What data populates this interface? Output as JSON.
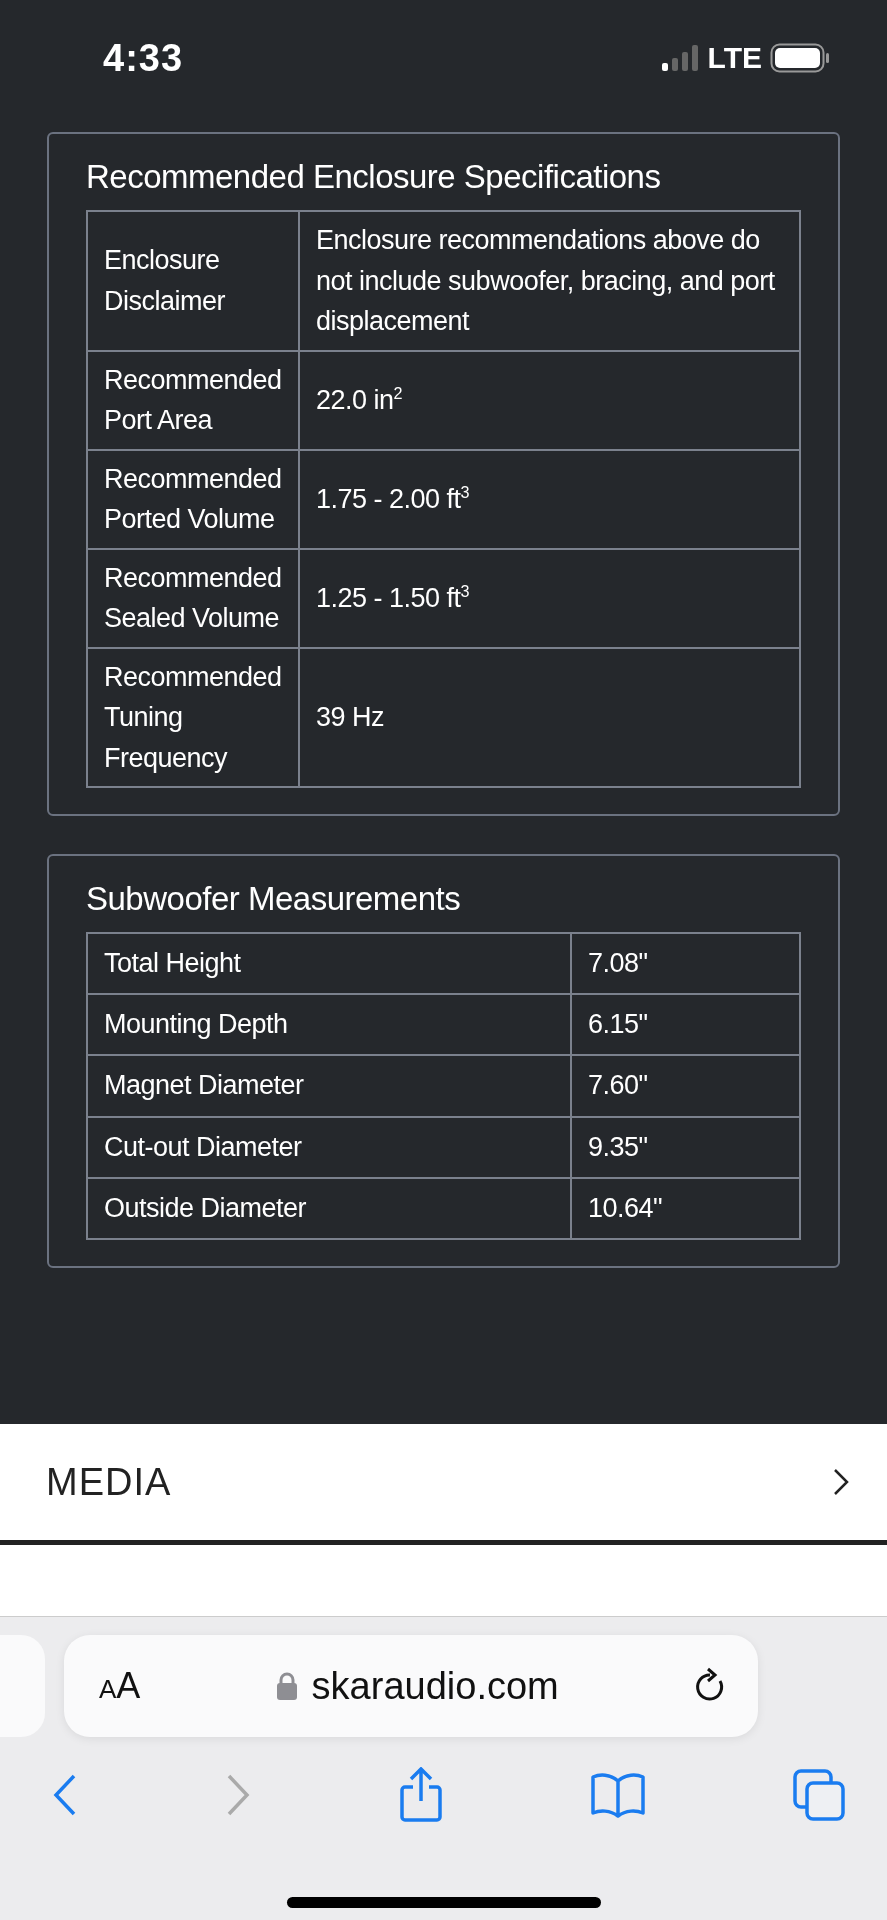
{
  "status_bar": {
    "time": "4:33",
    "network": "LTE"
  },
  "sections": [
    {
      "title": "Recommended Enclosure Specifications",
      "kind": "wide",
      "rows": [
        {
          "label": "Enclosure Disclaimer",
          "value": "Enclosure recommendations above do not include subwoofer, bracing, and port displacement"
        },
        {
          "label": "Recommended Port Area",
          "value": "22.0 in$^{2}$"
        },
        {
          "label": "Recommended Ported Volume",
          "value": "1.75 - 2.00 ft$^{3}$"
        },
        {
          "label": "Recommended Sealed Volume",
          "value": "1.25 - 1.50 ft$^{3}$"
        },
        {
          "label": "Recommended Tuning Frequency",
          "value": "39 Hz"
        }
      ]
    },
    {
      "title": "Subwoofer Measurements",
      "kind": "narrow",
      "rows": [
        {
          "label": "Total Height",
          "value": "7.08\""
        },
        {
          "label": "Mounting Depth",
          "value": "6.15\""
        },
        {
          "label": "Magnet Diameter",
          "value": "7.60\""
        },
        {
          "label": "Cut-out Diameter",
          "value": "9.35\""
        },
        {
          "label": "Outside Diameter",
          "value": "10.64\""
        }
      ]
    }
  ],
  "media": {
    "label": "MEDIA"
  },
  "browser": {
    "text_size": "AA",
    "url": "skaraudio.com"
  }
}
